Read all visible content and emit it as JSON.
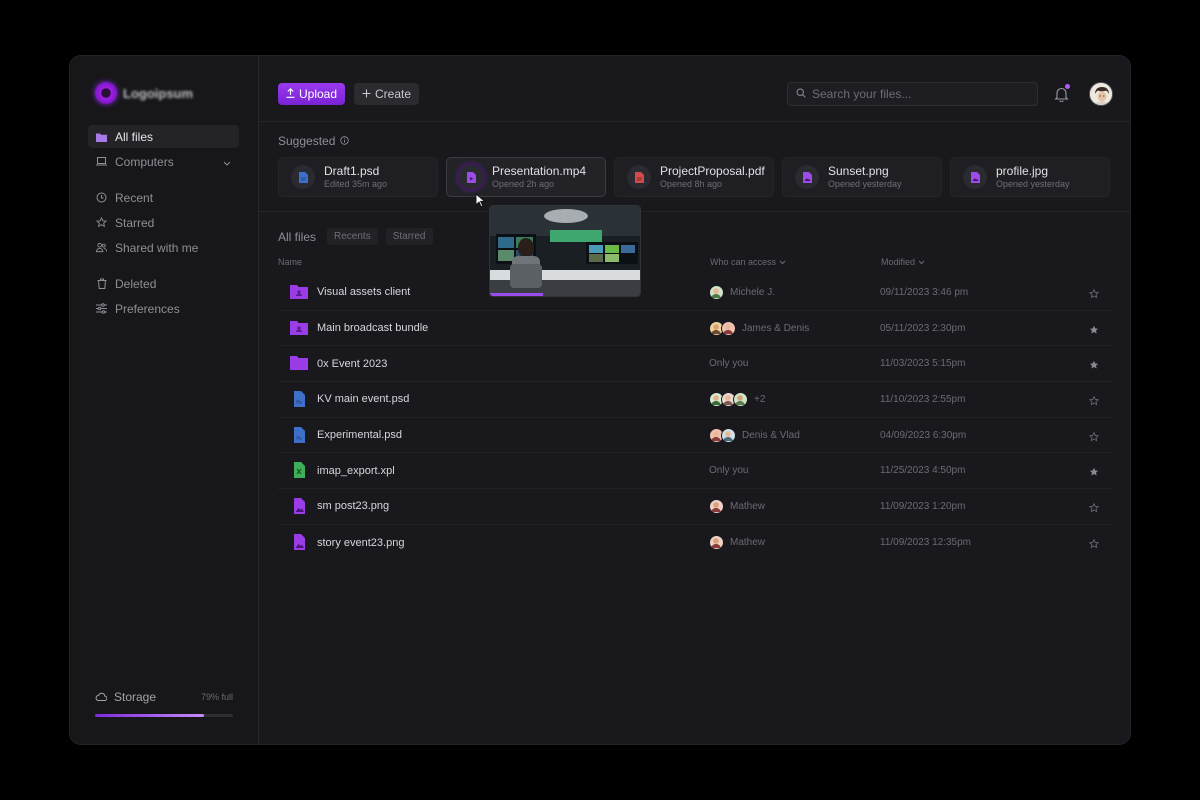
{
  "brand": {
    "name": "Logoipsum"
  },
  "sidebar": {
    "items": [
      {
        "label": "All files",
        "icon": "folder-icon",
        "active": true
      },
      {
        "label": "Computers",
        "icon": "laptop-icon",
        "expandable": true
      },
      {
        "label": "Recent",
        "icon": "clock-icon"
      },
      {
        "label": "Starred",
        "icon": "star-icon"
      },
      {
        "label": "Shared with me",
        "icon": "users-icon"
      },
      {
        "label": "Deleted",
        "icon": "trash-icon"
      },
      {
        "label": "Preferences",
        "icon": "sliders-icon"
      }
    ],
    "storage": {
      "label": "Storage",
      "percent_label": "79% full",
      "fill_fraction": 0.79
    }
  },
  "toolbar": {
    "upload_label": "Upload",
    "create_label": "Create",
    "search_placeholder": "Search your files..."
  },
  "suggested": {
    "title": "Suggested",
    "cards": [
      {
        "name": "Draft1.psd",
        "sub": "Edited 35m ago",
        "type": "psd"
      },
      {
        "name": "Presentation.mp4",
        "sub": "Opened 2h ago",
        "type": "video"
      },
      {
        "name": "ProjectProposal.pdf",
        "sub": "Opened 8h ago",
        "type": "pdf"
      },
      {
        "name": "Sunset.png",
        "sub": "Opened yesterday",
        "type": "image"
      },
      {
        "name": "profile.jpg",
        "sub": "Opened yesterday",
        "type": "image"
      }
    ]
  },
  "files": {
    "tabs": {
      "main": "All files",
      "recents": "Recents",
      "starred": "Starred"
    },
    "columns": {
      "name": "Name",
      "access": "Who can access",
      "modified": "Modified"
    },
    "rows": [
      {
        "name": "Visual assets client",
        "type": "shared-folder",
        "access": "Michele J.",
        "avatars": 1,
        "modified": "09/11/2023 3:46 pm",
        "starred": false
      },
      {
        "name": "Main broadcast bundle",
        "type": "shared-folder",
        "access": "James & Denis",
        "avatars": 2,
        "modified": "05/11/2023 2:30pm",
        "starred": true
      },
      {
        "name": "0x Event 2023",
        "type": "folder",
        "access": "Only you",
        "avatars": 0,
        "modified": "11/03/2023 5:15pm",
        "starred": true
      },
      {
        "name": "KV main event.psd",
        "type": "psd",
        "access": "+2",
        "avatars": 3,
        "modified": "11/10/2023 2:55pm",
        "starred": false
      },
      {
        "name": "Experimental.psd",
        "type": "psd",
        "access": "Denis & Vlad",
        "avatars": 2,
        "modified": "04/09/2023 6:30pm",
        "starred": false
      },
      {
        "name": "imap_export.xpl",
        "type": "sheet",
        "access": "Only you",
        "avatars": 0,
        "modified": "11/25/2023 4:50pm",
        "starred": true
      },
      {
        "name": "sm post23.png",
        "type": "image",
        "access": "Mathew",
        "avatars": 1,
        "modified": "11/09/2023 1:20pm",
        "starred": false
      },
      {
        "name": "story event23.png",
        "type": "image",
        "access": "Mathew",
        "avatars": 1,
        "modified": "11/09/2023 12:35pm",
        "starred": false
      }
    ]
  },
  "preview": {
    "progress_fraction": 0.35
  },
  "colors": {
    "accent": "#8b2ff0",
    "bg": "#19191d",
    "star_filled": "#8a8a92"
  }
}
